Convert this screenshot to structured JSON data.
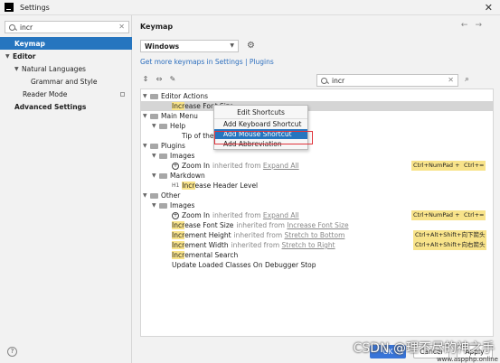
{
  "window": {
    "title": "Settings",
    "close_glyph": "✕"
  },
  "sidebar": {
    "search_value": "incr",
    "clear_glyph": "✕",
    "items": [
      {
        "label": "Keymap"
      },
      {
        "label": "Editor"
      },
      {
        "label": "Natural Languages"
      },
      {
        "label": "Grammar and Style"
      },
      {
        "label": "Reader Mode"
      },
      {
        "label": "Advanced Settings"
      }
    ]
  },
  "main": {
    "header": "Keymap",
    "nav_back": "←",
    "nav_forward": "→",
    "keymap_select": "Windows",
    "more_keymaps_link": "Get more keymaps in Settings | Plugins",
    "filter_value": "incr"
  },
  "tree": {
    "editor_actions": "Editor Actions",
    "increase_font_size_hl": "Incr",
    "increase_font_size_rest": "ease Font Size",
    "main_menu": "Main Menu",
    "help": "Help",
    "tip_of_the_day": "Tip of the D",
    "plugins": "Plugins",
    "images": "Images",
    "zoom_in": "Zoom In",
    "inherited_from": "inherited from",
    "expand_all": "Expand All",
    "sc_ctrl_numpad_plus": "Ctrl+NumPad +",
    "sc_ctrl_eq": "Ctrl+=",
    "markdown": "Markdown",
    "h1_prefix": "H1",
    "increase_header_level_hl": "Incr",
    "increase_header_level_rest": "ease Header Level",
    "other": "Other",
    "images2": "Images",
    "zoom_in2": "Zoom In",
    "expand_all2": "Expand All",
    "sc_ctrl_numpad_plus2": "Ctrl+NumPad +",
    "sc_ctrl_eq2": "Ctrl+=",
    "other_increase_font_hl": "Incr",
    "other_increase_font_rest": "ease Font Size",
    "increase_font_size_link": "Increase Font Size",
    "increment_height_hl": "Incr",
    "increment_height_rest": "ement Height",
    "stretch_to_bottom": "Stretch to Bottom",
    "sc_ctrl_alt_shift_down": "Ctrl+Alt+Shift+向下箭头",
    "increment_width_hl": "Incr",
    "increment_width_rest": "ement Width",
    "stretch_to_right": "Stretch to Right",
    "sc_ctrl_alt_shift_right": "Ctrl+Alt+Shift+向右箭头",
    "incremental_search_hl": "Incr",
    "incremental_search_rest": "emental Search",
    "update_loaded_classes": "Update Loaded Classes On Debugger Stop"
  },
  "context_menu": {
    "title": "Edit Shortcuts",
    "items": [
      {
        "label": "Add Keyboard Shortcut"
      },
      {
        "label": "Add Mouse Shortcut"
      },
      {
        "label": "Add Abbreviation"
      }
    ]
  },
  "footer": {
    "help": "?",
    "ok": "OK",
    "cancel": "Cancel",
    "apply": "Apply"
  },
  "watermark": {
    "text": "CSDN @理不尽的神之手",
    "sub": "www.aspphp.online"
  },
  "colors": {
    "accent": "#2675bf",
    "highlight": "#f8e38a",
    "alert_box": "#e0343c"
  }
}
